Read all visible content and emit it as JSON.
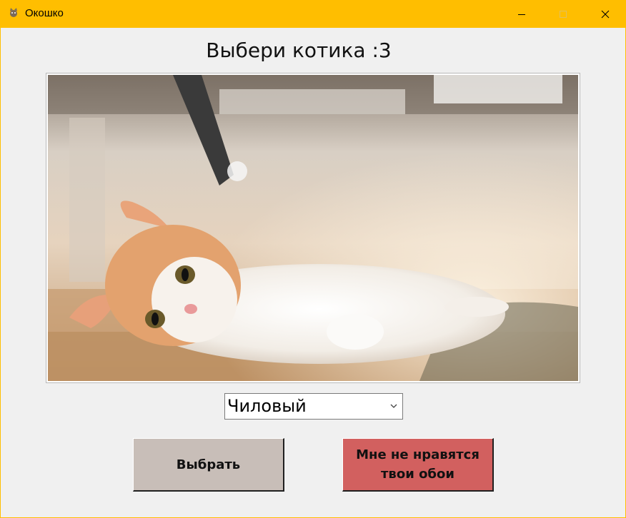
{
  "window": {
    "title": "Окошко",
    "icon": "cat-app-icon",
    "controls": [
      "minimize-icon",
      "maximize-icon",
      "close-icon"
    ]
  },
  "main": {
    "heading": "Выбери котика :3",
    "image": "kitten-lying-on-floor-photo",
    "selector": {
      "value": "Чиловый"
    },
    "buttons": {
      "choose": "Выбрать",
      "dislike": "Мне не нравятся\nтвои обои"
    }
  },
  "colors": {
    "titlebar": "#ffbe00",
    "choose_button": "#c8beb8",
    "dislike_button": "#d2605f",
    "background": "#f0f0f0"
  }
}
